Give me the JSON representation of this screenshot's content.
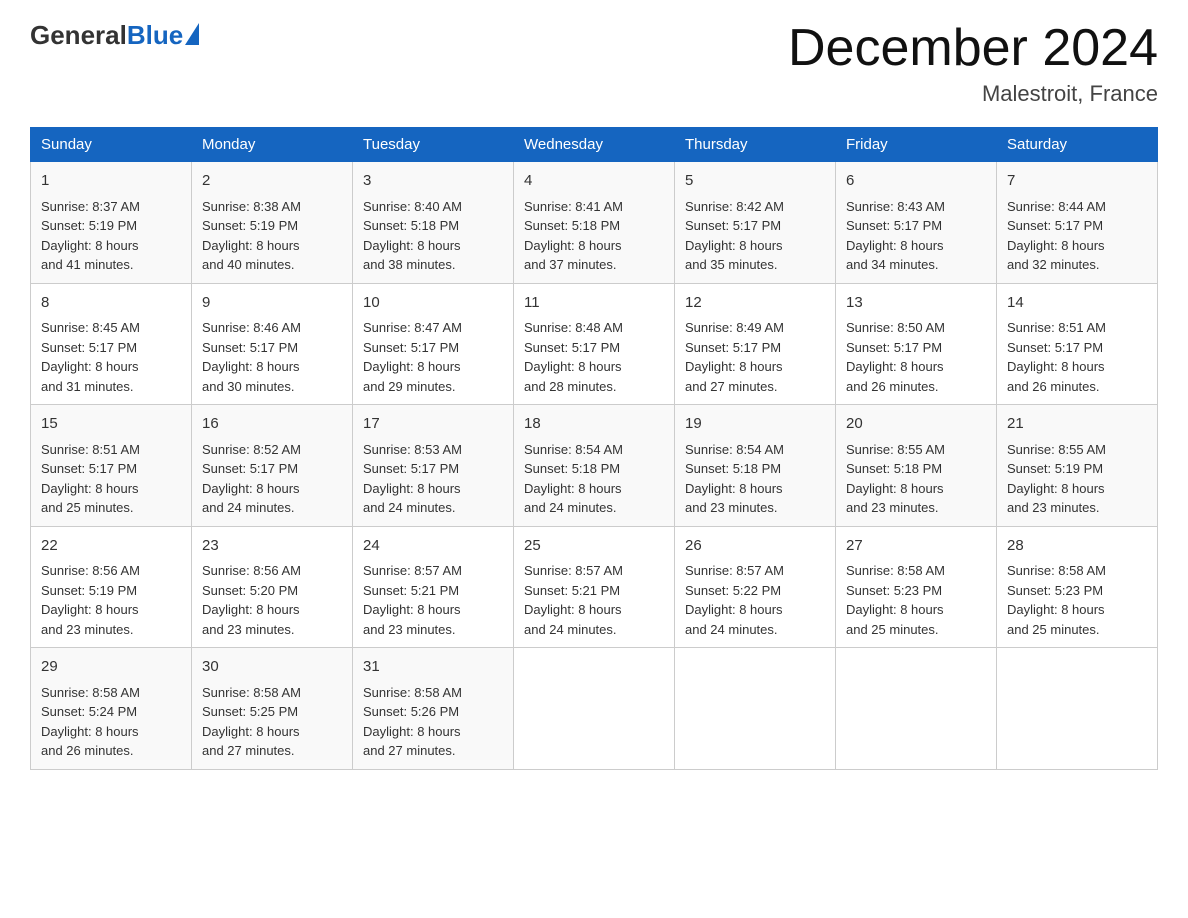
{
  "logo": {
    "general": "General",
    "blue": "Blue"
  },
  "title": {
    "month": "December 2024",
    "location": "Malestroit, France"
  },
  "headers": [
    "Sunday",
    "Monday",
    "Tuesday",
    "Wednesday",
    "Thursday",
    "Friday",
    "Saturday"
  ],
  "weeks": [
    [
      {
        "day": "1",
        "sunrise": "8:37 AM",
        "sunset": "5:19 PM",
        "daylight": "8 hours and 41 minutes."
      },
      {
        "day": "2",
        "sunrise": "8:38 AM",
        "sunset": "5:19 PM",
        "daylight": "8 hours and 40 minutes."
      },
      {
        "day": "3",
        "sunrise": "8:40 AM",
        "sunset": "5:18 PM",
        "daylight": "8 hours and 38 minutes."
      },
      {
        "day": "4",
        "sunrise": "8:41 AM",
        "sunset": "5:18 PM",
        "daylight": "8 hours and 37 minutes."
      },
      {
        "day": "5",
        "sunrise": "8:42 AM",
        "sunset": "5:17 PM",
        "daylight": "8 hours and 35 minutes."
      },
      {
        "day": "6",
        "sunrise": "8:43 AM",
        "sunset": "5:17 PM",
        "daylight": "8 hours and 34 minutes."
      },
      {
        "day": "7",
        "sunrise": "8:44 AM",
        "sunset": "5:17 PM",
        "daylight": "8 hours and 32 minutes."
      }
    ],
    [
      {
        "day": "8",
        "sunrise": "8:45 AM",
        "sunset": "5:17 PM",
        "daylight": "8 hours and 31 minutes."
      },
      {
        "day": "9",
        "sunrise": "8:46 AM",
        "sunset": "5:17 PM",
        "daylight": "8 hours and 30 minutes."
      },
      {
        "day": "10",
        "sunrise": "8:47 AM",
        "sunset": "5:17 PM",
        "daylight": "8 hours and 29 minutes."
      },
      {
        "day": "11",
        "sunrise": "8:48 AM",
        "sunset": "5:17 PM",
        "daylight": "8 hours and 28 minutes."
      },
      {
        "day": "12",
        "sunrise": "8:49 AM",
        "sunset": "5:17 PM",
        "daylight": "8 hours and 27 minutes."
      },
      {
        "day": "13",
        "sunrise": "8:50 AM",
        "sunset": "5:17 PM",
        "daylight": "8 hours and 26 minutes."
      },
      {
        "day": "14",
        "sunrise": "8:51 AM",
        "sunset": "5:17 PM",
        "daylight": "8 hours and 26 minutes."
      }
    ],
    [
      {
        "day": "15",
        "sunrise": "8:51 AM",
        "sunset": "5:17 PM",
        "daylight": "8 hours and 25 minutes."
      },
      {
        "day": "16",
        "sunrise": "8:52 AM",
        "sunset": "5:17 PM",
        "daylight": "8 hours and 24 minutes."
      },
      {
        "day": "17",
        "sunrise": "8:53 AM",
        "sunset": "5:17 PM",
        "daylight": "8 hours and 24 minutes."
      },
      {
        "day": "18",
        "sunrise": "8:54 AM",
        "sunset": "5:18 PM",
        "daylight": "8 hours and 24 minutes."
      },
      {
        "day": "19",
        "sunrise": "8:54 AM",
        "sunset": "5:18 PM",
        "daylight": "8 hours and 23 minutes."
      },
      {
        "day": "20",
        "sunrise": "8:55 AM",
        "sunset": "5:18 PM",
        "daylight": "8 hours and 23 minutes."
      },
      {
        "day": "21",
        "sunrise": "8:55 AM",
        "sunset": "5:19 PM",
        "daylight": "8 hours and 23 minutes."
      }
    ],
    [
      {
        "day": "22",
        "sunrise": "8:56 AM",
        "sunset": "5:19 PM",
        "daylight": "8 hours and 23 minutes."
      },
      {
        "day": "23",
        "sunrise": "8:56 AM",
        "sunset": "5:20 PM",
        "daylight": "8 hours and 23 minutes."
      },
      {
        "day": "24",
        "sunrise": "8:57 AM",
        "sunset": "5:21 PM",
        "daylight": "8 hours and 23 minutes."
      },
      {
        "day": "25",
        "sunrise": "8:57 AM",
        "sunset": "5:21 PM",
        "daylight": "8 hours and 24 minutes."
      },
      {
        "day": "26",
        "sunrise": "8:57 AM",
        "sunset": "5:22 PM",
        "daylight": "8 hours and 24 minutes."
      },
      {
        "day": "27",
        "sunrise": "8:58 AM",
        "sunset": "5:23 PM",
        "daylight": "8 hours and 25 minutes."
      },
      {
        "day": "28",
        "sunrise": "8:58 AM",
        "sunset": "5:23 PM",
        "daylight": "8 hours and 25 minutes."
      }
    ],
    [
      {
        "day": "29",
        "sunrise": "8:58 AM",
        "sunset": "5:24 PM",
        "daylight": "8 hours and 26 minutes."
      },
      {
        "day": "30",
        "sunrise": "8:58 AM",
        "sunset": "5:25 PM",
        "daylight": "8 hours and 27 minutes."
      },
      {
        "day": "31",
        "sunrise": "8:58 AM",
        "sunset": "5:26 PM",
        "daylight": "8 hours and 27 minutes."
      },
      null,
      null,
      null,
      null
    ]
  ],
  "labels": {
    "sunrise": "Sunrise:",
    "sunset": "Sunset:",
    "daylight": "Daylight:"
  }
}
